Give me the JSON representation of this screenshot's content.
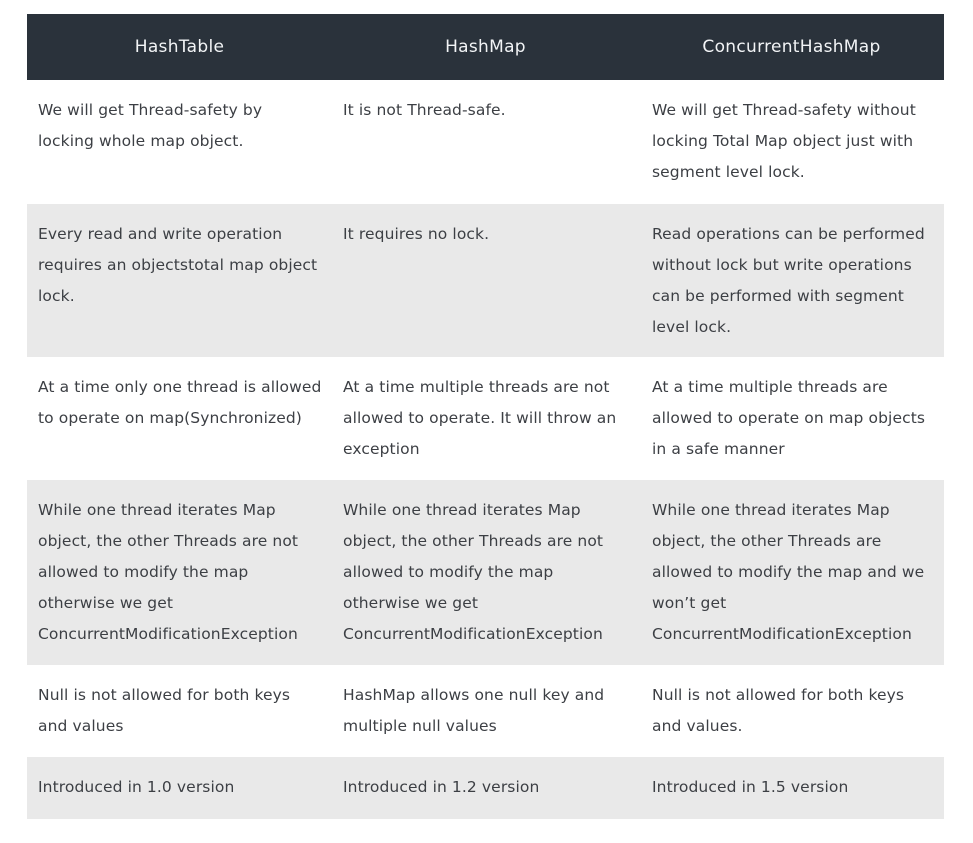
{
  "table": {
    "headers": [
      "HashTable",
      "HashMap",
      "ConcurrentHashMap"
    ],
    "rows": [
      [
        "We will get Thread-safety by locking whole map object.",
        "It is not Thread-safe.",
        "We will get Thread-safety without locking Total Map object just with segment level lock."
      ],
      [
        "Every read and write operation requires an objectstotal map object lock.",
        "It requires no lock.",
        "Read operations can be performed without lock but write operations can be performed with segment level lock."
      ],
      [
        "At a time only one thread is allowed to operate on map(Synchronized)",
        "At a time multiple threads are not allowed to operate. It will throw an exception",
        "At  a time multiple threads are allowed to operate on map objects in a safe manner"
      ],
      [
        "While one thread iterates Map object, the other Threads are not allowed to modify the map otherwise we get ConcurrentModificationException",
        "While one thread iterates Map object, the other Threads are not allowed to modify the map otherwise we get ConcurrentModificationException",
        "While one thread iterates Map object, the other Threads are allowed to modify the map and we won’t get ConcurrentModificationException"
      ],
      [
        "Null is not allowed for both keys and values",
        "HashMap allows one null key and multiple null values",
        "Null is not allowed for both keys and values."
      ],
      [
        "Introduced in 1.0 version",
        "Introduced in 1.2 version",
        "Introduced in 1.5 version"
      ]
    ]
  },
  "colors": {
    "header_bg": "#2a323b",
    "header_text": "#f2f4f6",
    "alt_row_bg": "#e9e9e9",
    "body_text": "#3c3f44"
  }
}
